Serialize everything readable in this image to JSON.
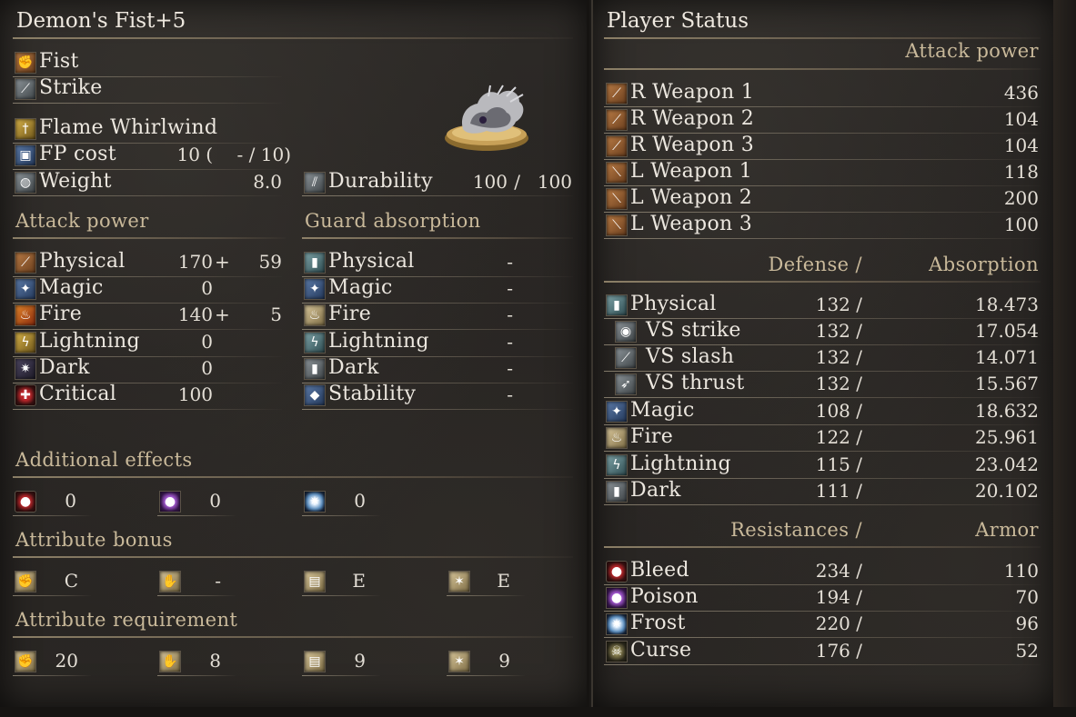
{
  "item": {
    "name": "Demon's Fist+5",
    "weapon_type": "Fist",
    "attack_type": "Strike",
    "skill": "Flame Whirlwind",
    "fp_cost_label": "FP cost",
    "fp_cost_value": "10",
    "fp_cost_paren": "(",
    "fp_cost_alt": "- / 10)",
    "weight_label": "Weight",
    "weight_value": "8.0",
    "durability_label": "Durability",
    "durability_current": "100",
    "durability_sep": "/",
    "durability_max": "100"
  },
  "attack_power": {
    "header": "Attack power",
    "rows": [
      {
        "label": "Physical",
        "base": "170",
        "plus": "+",
        "bonus": "59"
      },
      {
        "label": "Magic",
        "base": "0",
        "plus": "",
        "bonus": ""
      },
      {
        "label": "Fire",
        "base": "140",
        "plus": "+",
        "bonus": "5"
      },
      {
        "label": "Lightning",
        "base": "0",
        "plus": "",
        "bonus": ""
      },
      {
        "label": "Dark",
        "base": "0",
        "plus": "",
        "bonus": ""
      },
      {
        "label": "Critical",
        "base": "100",
        "plus": "",
        "bonus": ""
      }
    ]
  },
  "guard_absorption": {
    "header": "Guard absorption",
    "rows": [
      {
        "label": "Physical",
        "value": "-"
      },
      {
        "label": "Magic",
        "value": "-"
      },
      {
        "label": "Fire",
        "value": "-"
      },
      {
        "label": "Lightning",
        "value": "-"
      },
      {
        "label": "Dark",
        "value": "-"
      },
      {
        "label": "Stability",
        "value": "-"
      }
    ]
  },
  "additional_effects": {
    "header": "Additional effects",
    "items": [
      {
        "icon": "bleed-icon",
        "value": "0"
      },
      {
        "icon": "poison-icon",
        "value": "0"
      },
      {
        "icon": "frost-icon",
        "value": "0"
      }
    ]
  },
  "attribute_bonus": {
    "header": "Attribute bonus",
    "items": [
      {
        "icon": "strength-icon",
        "value": "C"
      },
      {
        "icon": "dexterity-icon",
        "value": "-"
      },
      {
        "icon": "intelligence-icon",
        "value": "E"
      },
      {
        "icon": "faith-icon",
        "value": "E"
      }
    ]
  },
  "attribute_requirement": {
    "header": "Attribute requirement",
    "items": [
      {
        "icon": "strength-icon",
        "value": "20"
      },
      {
        "icon": "dexterity-icon",
        "value": "8"
      },
      {
        "icon": "intelligence-icon",
        "value": "9"
      },
      {
        "icon": "faith-icon",
        "value": "9"
      }
    ]
  },
  "player_status": {
    "title": "Player Status",
    "attack_header": "Attack power",
    "weapons": [
      {
        "label": "R Weapon 1",
        "value": "436"
      },
      {
        "label": "R Weapon 2",
        "value": "104"
      },
      {
        "label": "R Weapon 3",
        "value": "104"
      },
      {
        "label": "L Weapon 1",
        "value": "118"
      },
      {
        "label": "L Weapon 2",
        "value": "200"
      },
      {
        "label": "L Weapon 3",
        "value": "100"
      }
    ],
    "defense_header": "Defense /",
    "absorption_header": "Absorption",
    "defense": [
      {
        "label": "Physical",
        "def": "132 /",
        "abs": "18.473"
      },
      {
        "label": "VS strike",
        "def": "132 /",
        "abs": "17.054"
      },
      {
        "label": "VS slash",
        "def": "132 /",
        "abs": "14.071"
      },
      {
        "label": "VS thrust",
        "def": "132 /",
        "abs": "15.567"
      },
      {
        "label": "Magic",
        "def": "108 /",
        "abs": "18.632"
      },
      {
        "label": "Fire",
        "def": "122 /",
        "abs": "25.961"
      },
      {
        "label": "Lightning",
        "def": "115 /",
        "abs": "23.042"
      },
      {
        "label": "Dark",
        "def": "111 /",
        "abs": "20.102"
      }
    ],
    "resist_header": "Resistances /",
    "armor_header": "Armor",
    "resistances": [
      {
        "label": "Bleed",
        "res": "234 /",
        "armor": "110"
      },
      {
        "label": "Poison",
        "res": "194 /",
        "armor": "70"
      },
      {
        "label": "Frost",
        "res": "220 /",
        "armor": "96"
      },
      {
        "label": "Curse",
        "res": "176 /",
        "armor": "52"
      }
    ]
  }
}
